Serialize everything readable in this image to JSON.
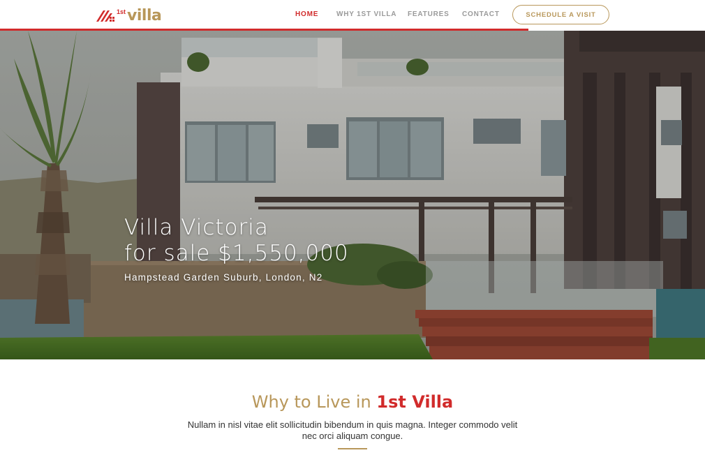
{
  "brand": {
    "superscript": "1st",
    "name": "villa",
    "accent_color": "#d12b2b",
    "gold_color": "#b8975a"
  },
  "nav": {
    "items": [
      {
        "label": "HOME",
        "active": true
      },
      {
        "label": "WHY 1ST VILLA",
        "active": false
      },
      {
        "label": "FEATURES",
        "active": false
      },
      {
        "label": "CONTACT",
        "active": false
      }
    ],
    "cta_label": "SCHEDULE A VISIT"
  },
  "hero": {
    "title_line1": "Villa Victoria",
    "title_line2": "for sale $1,550,000",
    "subtitle": "Hampstead Garden Suburb, London, N2"
  },
  "section": {
    "heading_prefix": "Why to Live in ",
    "heading_accent": "1st Villa",
    "body": "Nullam in nisl vitae elit sollicitudin bibendum in quis magna. Integer commodo velit nec orci aliquam congue."
  }
}
